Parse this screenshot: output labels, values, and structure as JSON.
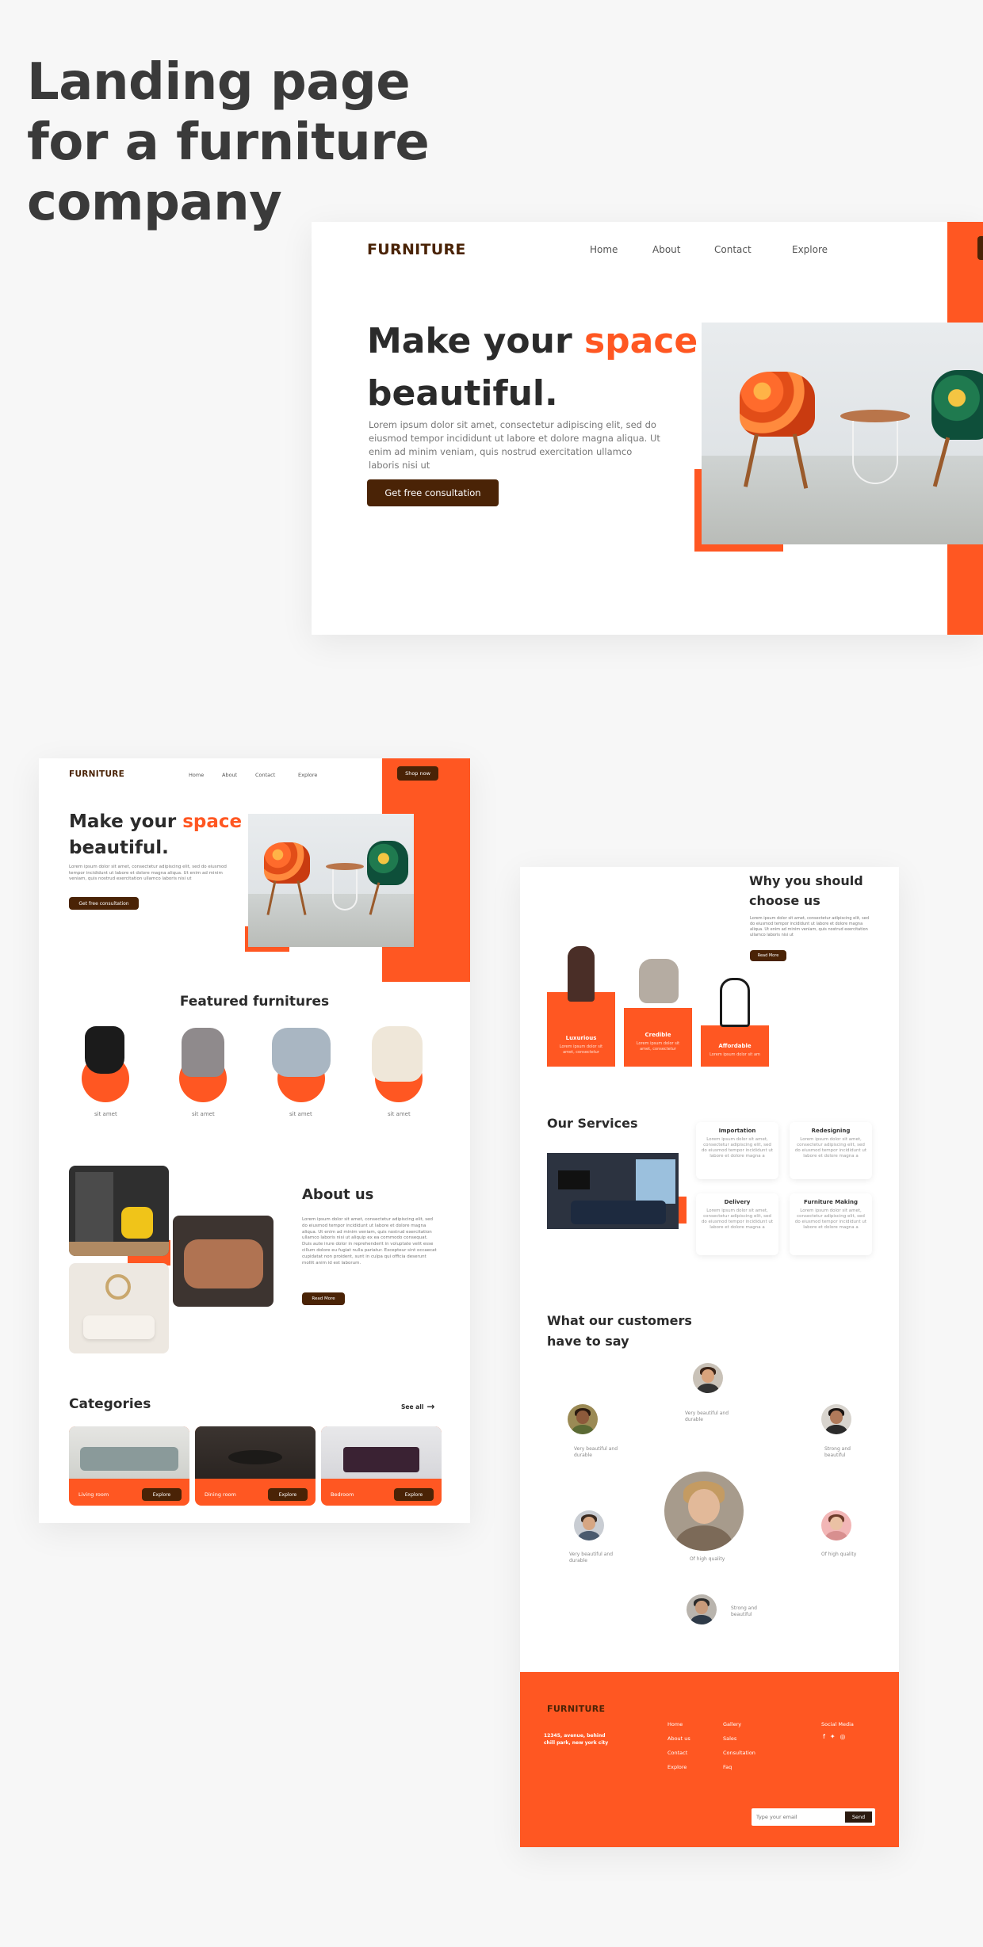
{
  "page_title": "Landing page for a furniture company",
  "colors": {
    "accent": "#ff5722",
    "brand": "#4a2306",
    "text": "#2b2b2b"
  },
  "hero_large": {
    "brand": "FURNITURE",
    "nav": [
      "Home",
      "About",
      "Contact",
      "Explore"
    ],
    "headline_a": "Make your ",
    "headline_accent": "space",
    "headline_b": "beautiful.",
    "body": "Lorem ipsum dolor sit amet, consectetur adipiscing elit, sed do eiusmod tempor incididunt ut labore et dolore magna aliqua. Ut enim ad minim veniam, quis nostrud exercitation ullamco laboris nisi ut",
    "cta": "Get free consultation"
  },
  "left_page": {
    "brand": "FURNITURE",
    "nav": [
      "Home",
      "About",
      "Contact",
      "Explore"
    ],
    "shop_now": "Shop now",
    "headline_a": "Make your ",
    "headline_accent": "space",
    "headline_b": "beautiful.",
    "body": "Lorem ipsum dolor sit amet, consectetur adipiscing elit, sed do eiusmod tempor incididunt ut labore et dolore magna aliqua. Ut enim ad minim veniam, quis nostrud exercitation ullamco laboris nisi ut",
    "cta": "Get free consultation",
    "featured_title": "Featured furnitures",
    "featured_items": [
      "sit amet",
      "sit amet",
      "sit amet",
      "sit amet"
    ],
    "about_title": "About us",
    "about_body": "Lorem ipsum dolor sit amet, consectetur adipiscing elit, sed do eiusmod tempor incididunt ut labore et dolore magna aliqua. Ut enim ad minim veniam, quis nostrud exercitation ullamco laboris nisi ut aliquip ex ea commodo consequat. Duis aute irure dolor in reprehenderit in voluptate velit esse cillum dolore eu fugiat nulla pariatur. Excepteur sint occaecat cupidatat non proident, sunt in culpa qui officia deserunt mollit anim id est laborum.",
    "about_cta": "Read More",
    "categories_title": "Categories",
    "see_all": "See all",
    "categories": [
      {
        "label": "Living room",
        "button": "Explore"
      },
      {
        "label": "Dining room",
        "button": "Explore"
      },
      {
        "label": "Bedroom",
        "button": "Explore"
      }
    ]
  },
  "right_page": {
    "why_title_1": "Why you should",
    "why_title_2": "choose us",
    "why_body": "Lorem ipsum dolor sit amet, consectetur adipiscing elit, sed do eiusmod tempor incididunt ut labore et dolore magna aliqua. Ut enim ad minim veniam, quis nostrud exercitation ullamco laboris nisi ut",
    "why_cta": "Read More",
    "features": [
      {
        "title": "Luxurious",
        "text": "Lorem ipsum dolor sit amet, consectetur"
      },
      {
        "title": "Credible",
        "text": "Lorem ipsum dolor sit amet, consectetur"
      },
      {
        "title": "Affordable",
        "text": "Lorem ipsum dolor sit am"
      }
    ],
    "services_title": "Our Services",
    "services": [
      {
        "title": "Importation",
        "text": "Lorem ipsum dolor sit amet, consectetur adipiscing elit, sed do eiusmod tempor incididunt ut labore et dolore magna a"
      },
      {
        "title": "Redesigning",
        "text": "Lorem ipsum dolor sit amet, consectetur adipiscing elit, sed do eiusmod tempor incididunt ut labore et dolore magna a"
      },
      {
        "title": "Delivery",
        "text": "Lorem ipsum dolor sit amet, consectetur adipiscing elit, sed do eiusmod tempor incididunt ut labore et dolore magna a"
      },
      {
        "title": "Furniture Making",
        "text": "Lorem ipsum dolor sit amet, consectetur adipiscing elit, sed do eiusmod tempor incididunt ut labore et dolore magna a"
      }
    ],
    "testimonials_title_1": "What our customers",
    "testimonials_title_2": "have to say",
    "testimonials": [
      "Very beautiful and durable",
      "Very beautiful and durable",
      "Strong and beautiful",
      "Very beautiful and durable",
      "Of high quality",
      "Of high quality",
      "Strong and beautiful"
    ],
    "footer": {
      "brand": "FURNITURE",
      "address": "12345, avenue, behind chill park, new york city",
      "col1": [
        "Home",
        "About us",
        "Contact",
        "Explore"
      ],
      "col2": [
        "Gallery",
        "Sales",
        "Consultation",
        "Faq"
      ],
      "social_title": "Social Media",
      "social_icons": [
        "f",
        "✦",
        "◎"
      ],
      "email_placeholder": "Type your email",
      "send": "Send"
    }
  }
}
